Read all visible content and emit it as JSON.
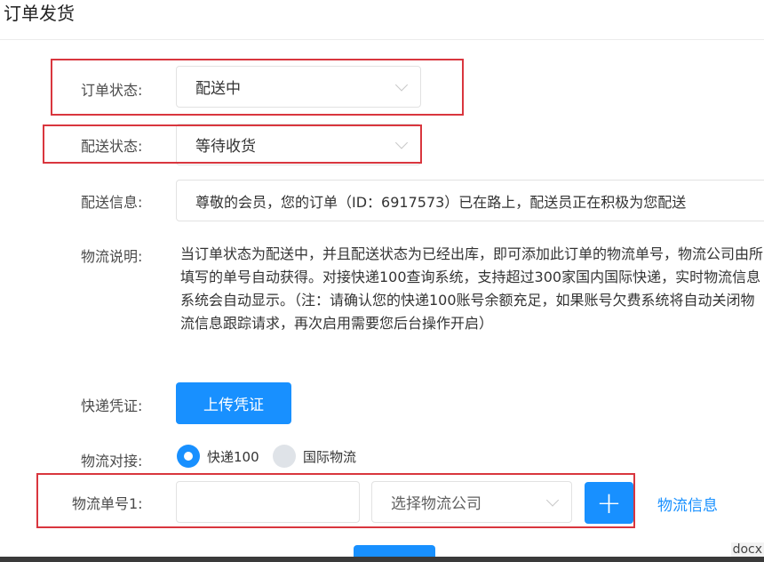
{
  "dialog": {
    "title": "订单发货"
  },
  "order_status": {
    "label": "订单状态:",
    "value": "配送中"
  },
  "delivery_status": {
    "label": "配送状态:",
    "value": "等待收货"
  },
  "delivery_info": {
    "label": "配送信息:",
    "value": "尊敬的会员，您的订单（ID：6917573）已在路上，配送员正在积极为您配送"
  },
  "logistics_desc": {
    "label": "物流说明:",
    "text": "当订单状态为配送中，并且配送状态为已经出库，即可添加此订单的物流单号，物流公司由所填写的单号自动获得。对接快递100查询系统，支持超过300家国内国际快递，实时物流信息系统会自动显示。（注：请确认您的快递100账号余额充足，如果账号欠费系统将自动关闭物流信息跟踪请求，再次启用需要您后台操作开启）"
  },
  "express_voucher": {
    "label": "快递凭证:",
    "button": "上传凭证"
  },
  "logistics_connect": {
    "label": "物流对接:",
    "options": [
      {
        "label": "快递100",
        "selected": true
      },
      {
        "label": "国际物流",
        "selected": false
      }
    ]
  },
  "tracking": {
    "label": "物流单号1:",
    "input_value": "",
    "company_placeholder": "选择物流公司",
    "add_label": "+",
    "info_link": "物流信息"
  },
  "corner_text": "docx",
  "colors": {
    "primary": "#1890ff",
    "highlight": "#d9363e"
  }
}
